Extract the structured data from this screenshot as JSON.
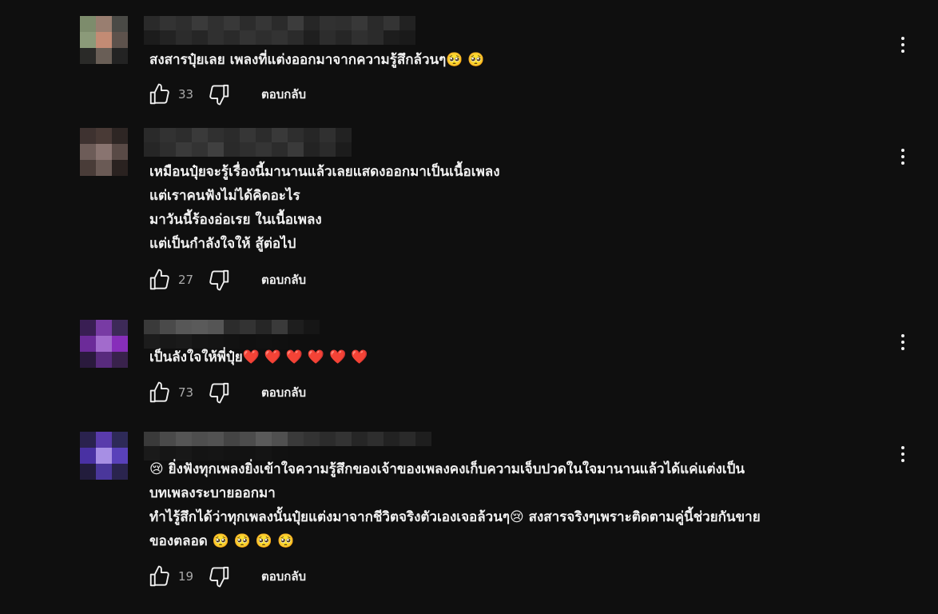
{
  "comments": [
    {
      "text": "สงสารปุ๋ยเลย เพลงที่แต่งออกมาจากความรู้สึกล้วนๆ🥺 🥺",
      "likes": "33",
      "reply_label": "ตอบกลับ"
    },
    {
      "text": "เหมือนปุ๋ยจะรู้เรื่องนี้มานานแล้วเลยแสดงออกมาเป็นเนื้อเพลง\nแต่เราคนฟังไม่ได้คิดอะไร\nมาวันนี้ร้องอ่อเรย ในเนื้อเพลง\nแต่เป็นกำลังใจให้ สู้ต่อไป",
      "likes": "27",
      "reply_label": "ตอบกลับ"
    },
    {
      "text": "เป็นลังใจให้พี่ปุ๋ย❤️ ❤️ ❤️ ❤️ ❤️ ❤️",
      "likes": "73",
      "reply_label": "ตอบกลับ"
    },
    {
      "text": "😢 ยิ่งฟังทุกเพลงยิ่งเข้าใจความรู้สึกของเจ้าของเพลงคงเก็บความเจ็บปวดในใจมานานแล้วได้แค่แต่งเป็น\nบทเพลงระบายออกมา\nทำไรู้สึกได้ว่าทุกเพลงนั้นปุ๋ยแต่งมาจากชีวิตจริงตัวเองเจอล้วนๆ😢 สงสารจริงๆเพราะติดตามคู่นี้ช่วยกันขาย\nของตลอด 🥺 🥺 🥺 🥺",
      "likes": "19",
      "reply_label": "ตอบกลับ"
    }
  ],
  "icons": {
    "like": "thumb-up-icon",
    "dislike": "thumb-down-icon",
    "menu": "more-vert-icon"
  },
  "colors": {
    "background": "#0f0f0f",
    "text": "#f1f1f1",
    "secondary_text": "#aaaaaa"
  }
}
